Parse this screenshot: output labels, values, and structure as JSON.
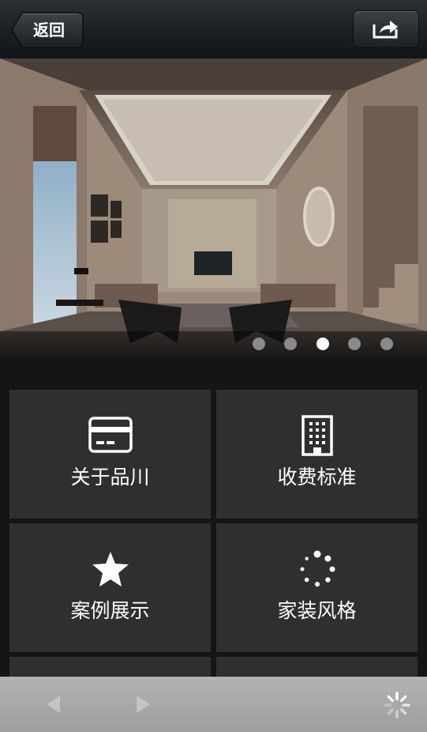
{
  "header": {
    "back_label": "返回",
    "back_icon": "back-arrow-icon",
    "share_icon": "share-icon"
  },
  "banner": {
    "slide_count": 5,
    "active_slide": 3
  },
  "menu": {
    "items": [
      {
        "label": "关于品川",
        "icon": "id-card-icon"
      },
      {
        "label": "收费标准",
        "icon": "building-icon"
      },
      {
        "label": "案例展示",
        "icon": "star-icon"
      },
      {
        "label": "家装风格",
        "icon": "loading-dots-icon"
      }
    ]
  },
  "toolbar": {
    "back_icon": "triangle-left-icon",
    "forward_icon": "triangle-right-icon",
    "refresh_icon": "loading-spinner-icon"
  },
  "colors": {
    "tile_bg": "#2f2f2f",
    "page_bg": "#151515",
    "toolbar_bg": "#a8a8a8"
  }
}
